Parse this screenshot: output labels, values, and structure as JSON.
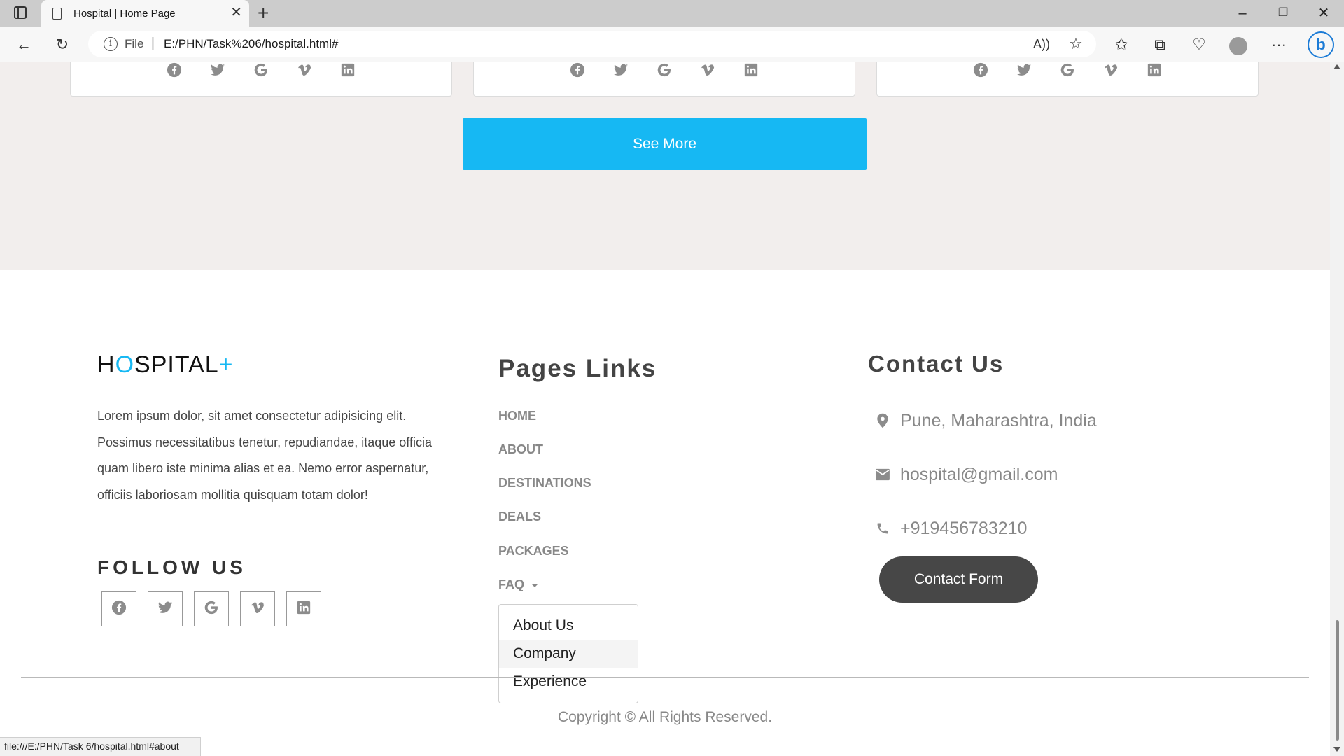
{
  "browser": {
    "tab_title": "Hospital | Home Page",
    "address_label": "File",
    "address_url": "E:/PHN/Task%206/hospital.html#",
    "status_url": "file:///E:/PHN/Task 6/hospital.html#about"
  },
  "hero": {
    "see_more_label": "See More"
  },
  "footer": {
    "brand": {
      "part1": "H",
      "accent_o": "O",
      "part2": "SPITAL",
      "accent_plus": "+"
    },
    "description": "Lorem ipsum dolor, sit amet consectetur adipisicing elit. Possimus necessitatibus tenetur, repudiandae, itaque officia quam libero iste minima alias et ea. Nemo error aspernatur, officiis laboriosam mollitia quisquam totam dolor!",
    "follow_heading": "FOLLOW US",
    "pages_heading": "Pages Links",
    "links": [
      "HOME",
      "ABOUT",
      "DESTINATIONS",
      "DEALS",
      "PACKAGES",
      "FAQ"
    ],
    "dropdown": [
      "About Us",
      "Company",
      "Experience"
    ],
    "contact_heading": "Contact Us",
    "contact": {
      "address": "Pune, Maharashtra, India",
      "email": "hospital@gmail.com",
      "phone": "+919456783210"
    },
    "contact_button": "Contact Form",
    "copyright": "Copyright © All Rights Reserved."
  },
  "social_icons": [
    "facebook-icon",
    "twitter-icon",
    "google-icon",
    "vimeo-icon",
    "linkedin-icon"
  ],
  "colors": {
    "accent": "#16b8f3",
    "section_bg": "#f2eeed",
    "dark_button": "#474747",
    "muted_text": "#888888"
  }
}
